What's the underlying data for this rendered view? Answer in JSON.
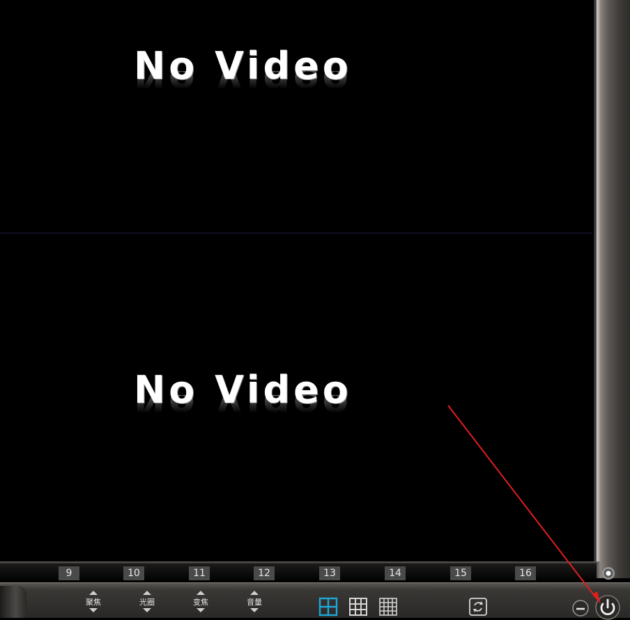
{
  "panes": [
    {
      "status_text": "No Video"
    },
    {
      "status_text": "No Video"
    }
  ],
  "channels": [
    "9",
    "10",
    "11",
    "12",
    "13",
    "14",
    "15",
    "16"
  ],
  "controls": [
    {
      "label": "聚焦"
    },
    {
      "label": "光圈"
    },
    {
      "label": "变焦"
    },
    {
      "label": "音量"
    }
  ],
  "layout_buttons": [
    {
      "icon": "grid-2x2-icon",
      "active": true
    },
    {
      "icon": "grid-3x3-icon",
      "active": false
    },
    {
      "icon": "grid-4x4-icon",
      "active": false
    }
  ],
  "icons": {
    "refresh": "refresh-icon",
    "minimize": "minus-icon",
    "power": "power-icon"
  },
  "colors": {
    "active_layout": "#1ea7d8",
    "annotation_arrow": "#e21e1e"
  }
}
